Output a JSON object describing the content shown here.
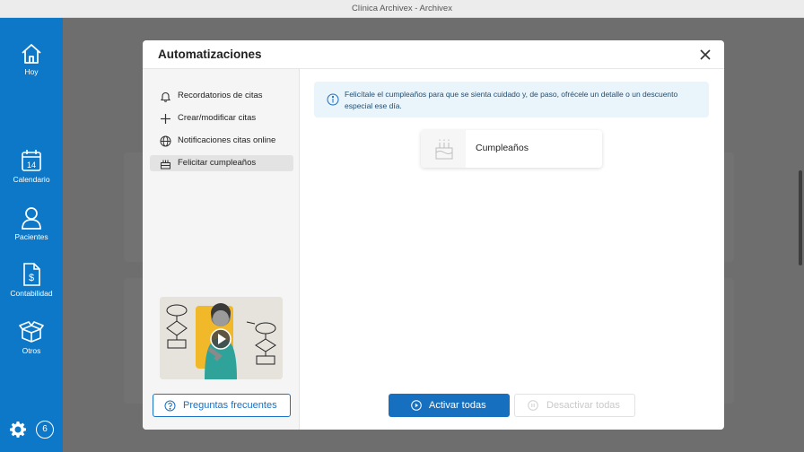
{
  "window": {
    "title": "Clínica Archivex - Archivex"
  },
  "sidebar": {
    "items": [
      {
        "label": "Hoy",
        "icon": "home-icon"
      },
      {
        "label": "Calendario",
        "icon": "calendar-icon",
        "day": "14"
      },
      {
        "label": "Pacientes",
        "icon": "user-icon"
      },
      {
        "label": "Contabilidad",
        "icon": "invoice-dollar-icon"
      },
      {
        "label": "Otros",
        "icon": "box-icon"
      }
    ],
    "settings_icon": "gear-icon",
    "badge": "6"
  },
  "modal": {
    "title": "Automatizaciones",
    "menu": [
      {
        "label": "Recordatorios de citas",
        "icon": "bell-icon"
      },
      {
        "label": "Crear/modificar citas",
        "icon": "plus-icon"
      },
      {
        "label": "Notificaciones citas online",
        "icon": "globe-icon"
      },
      {
        "label": "Felicitar cumpleaños",
        "icon": "cake-icon",
        "active": true
      }
    ],
    "faq_label": "Preguntas frecuentes",
    "info_text": "Felicítale el cumpleaños para que se sienta cuidado y, de paso, ofrécele un detalle o un descuento especial ese día.",
    "cards": [
      {
        "label": "Cumpleaños",
        "icon": "cake-icon"
      }
    ],
    "activate_all": "Activar todas",
    "deactivate_all": "Desactivar todas"
  },
  "colors": {
    "brand": "#0d78c8",
    "primary_button": "#1670bf",
    "info_bg": "#eaf4fb"
  }
}
